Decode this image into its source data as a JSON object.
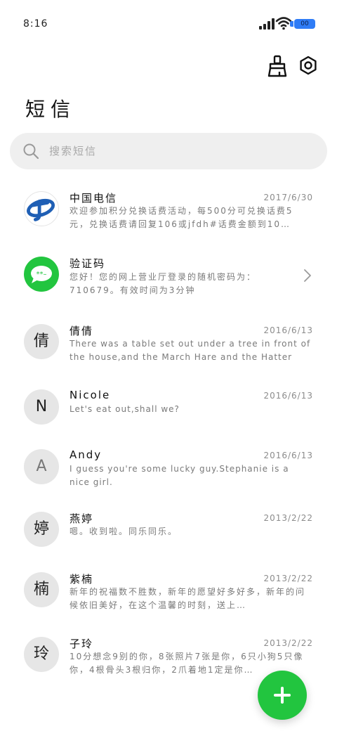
{
  "status_bar": {
    "time": "8:16",
    "battery_label": "00"
  },
  "header": {
    "title": "短信"
  },
  "search": {
    "placeholder": "搜索短信"
  },
  "messages": [
    {
      "sender": "中国电信",
      "date": "2017/6/30",
      "avatar_text": "",
      "avatar_icon": "china-telecom-logo-icon",
      "preview": "欢迎参加积分兑换话费活动，每500分可兑换话费5元，兑换话费请回复106或jfdh#话费金额到10…"
    },
    {
      "sender": "验证码",
      "date": "",
      "avatar_text": "",
      "avatar_icon": "message-bubble-icon",
      "preview": "您好！您的网上营业厅登录的随机密码为：710679。有效时间为3分钟"
    },
    {
      "sender": "倩倩",
      "date": "2016/6/13",
      "avatar_text": "倩",
      "preview": "There was a table set out under a tree in front of the house,and the March Hare and the Hatter were…"
    },
    {
      "sender": "Nicole",
      "date": "2016/6/13",
      "avatar_text": "N",
      "preview": "Let's eat out,shall we?"
    },
    {
      "sender": "Andy",
      "date": "2016/6/13",
      "avatar_text": "A",
      "preview": "I guess you're some lucky guy.Stephanie is a nice girl."
    },
    {
      "sender": "燕婷",
      "date": "2013/2/22",
      "avatar_text": "婷",
      "preview": "嗯。收到啦。同乐同乐。"
    },
    {
      "sender": "紫楠",
      "date": "2013/2/22",
      "avatar_text": "楠",
      "preview": "新年的祝福数不胜数，新年的愿望好多好多，新年的问候依旧美好，在这个温馨的时刻，送上…"
    },
    {
      "sender": "子玲",
      "date": "2013/2/22",
      "avatar_text": "玲",
      "preview": "10分想念9别的你，8张照片7张是你，6只小狗5只像你，4根骨头3根归你，2爪着地1定是你…"
    }
  ],
  "colors": {
    "accent": "#22c53f",
    "battery": "#2f7cf6",
    "search_bg": "#efefef",
    "avatar_bg": "#e6e6e6"
  }
}
